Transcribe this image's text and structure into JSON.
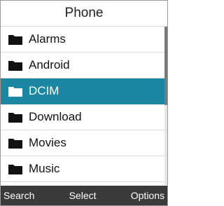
{
  "header": {
    "title": "Phone"
  },
  "list": {
    "items": [
      {
        "label": "Alarms",
        "icon": "folder-icon",
        "selected": false
      },
      {
        "label": "Android",
        "icon": "folder-icon",
        "selected": false
      },
      {
        "label": "DCIM",
        "icon": "folder-icon",
        "selected": true
      },
      {
        "label": "Download",
        "icon": "folder-icon",
        "selected": false
      },
      {
        "label": "Movies",
        "icon": "folder-icon",
        "selected": false
      },
      {
        "label": "Music",
        "icon": "folder-icon",
        "selected": false
      }
    ]
  },
  "softkeys": {
    "left": "Search",
    "center": "Select",
    "right": "Options"
  },
  "colors": {
    "selection": "#1b87a2",
    "softkey_bar": "#3a3a3a"
  }
}
